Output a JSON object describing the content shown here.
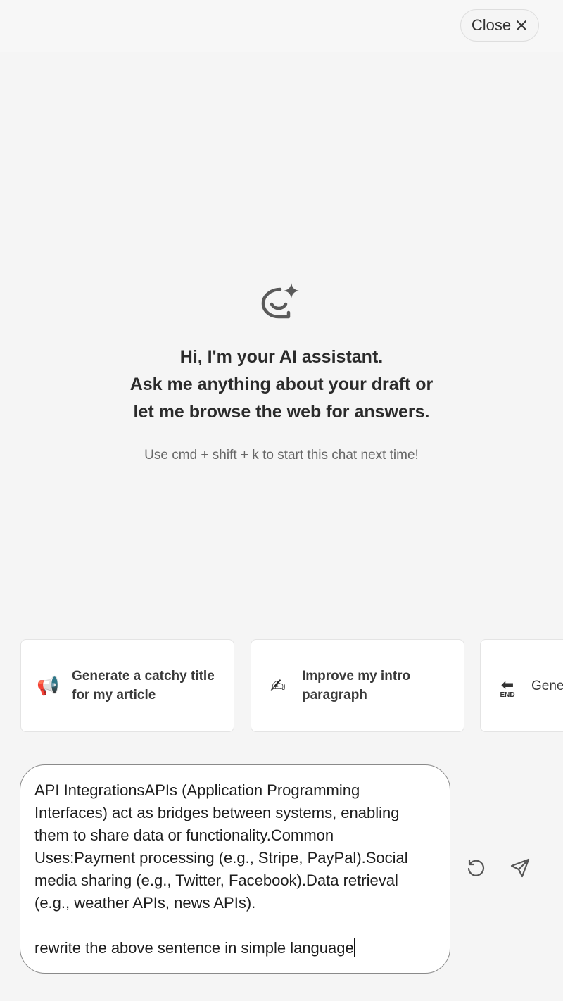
{
  "header": {
    "close_label": "Close"
  },
  "hero": {
    "icon": "ai-chat-sparkle-icon",
    "title_lines": [
      "Hi, I'm your AI assistant.",
      "Ask me anything about your draft or",
      "let me browse the web for answers."
    ],
    "hint": "Use cmd + shift + k to start this chat next time!"
  },
  "suggestions": [
    {
      "icon": "megaphone-icon",
      "emoji": "📢",
      "label": "Generate a catchy title for my article"
    },
    {
      "icon": "writing-hand-icon",
      "emoji": "✍",
      "label": "Improve my intro paragraph"
    },
    {
      "icon": "end-arrow-icon",
      "emoji": "END",
      "label": "Gene"
    }
  ],
  "composer": {
    "text": "API IntegrationsAPIs (Application Programming Interfaces) act as bridges between systems, enabling them to share data or functionality.Common Uses:Payment processing (e.g., Stripe, PayPal).Social media sharing (e.g., Twitter, Facebook).Data retrieval (e.g., weather APIs, news APIs).\n\nrewrite the above sentence in simple language",
    "refresh_icon": "refresh-icon",
    "send_icon": "send-icon"
  },
  "colors": {
    "background": "#f5f5f5",
    "card": "#ffffff",
    "text_primary": "#2b2b2b",
    "text_muted": "#666666"
  }
}
